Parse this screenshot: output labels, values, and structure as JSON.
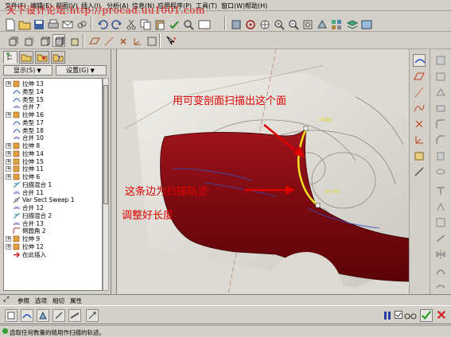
{
  "watermark": "天下设计论坛:http://procad.uu1001.com",
  "menu": {
    "items": [
      "文件(F)",
      "编辑(E)",
      "视图(V)",
      "插入(I)",
      "分析(A)",
      "信息(N)",
      "应用程序(P)",
      "工具(T)",
      "窗口(W)",
      "帮助(H)"
    ]
  },
  "panel": {
    "show_dropdown": "显示(S)",
    "settings_dropdown": "设置(G)",
    "tree": [
      {
        "label": "拉伸 13",
        "expand": true,
        "icon": "extrude-icon"
      },
      {
        "label": "类型 14",
        "expand": false,
        "icon": "sketch-icon"
      },
      {
        "label": "类型 15",
        "expand": false,
        "icon": "sketch-icon"
      },
      {
        "label": "合并 7",
        "expand": false,
        "icon": "merge-icon"
      },
      {
        "label": "拉伸 16",
        "expand": true,
        "icon": "extrude-icon"
      },
      {
        "label": "类型 17",
        "expand": false,
        "icon": "sketch-icon"
      },
      {
        "label": "类型 18",
        "expand": false,
        "icon": "sketch-icon"
      },
      {
        "label": "合并 10",
        "expand": false,
        "icon": "merge-icon"
      },
      {
        "label": "拉伸 8",
        "expand": true,
        "icon": "extrude-icon"
      },
      {
        "label": "拉伸 14",
        "expand": true,
        "icon": "extrude-icon"
      },
      {
        "label": "拉伸 15",
        "expand": true,
        "icon": "extrude-icon"
      },
      {
        "label": "拉伸 11",
        "expand": true,
        "icon": "extrude-icon"
      },
      {
        "label": "拉伸 6",
        "expand": true,
        "icon": "extrude-icon"
      },
      {
        "label": "扫描混合 1",
        "expand": false,
        "icon": "sweep-blend-icon"
      },
      {
        "label": "合并 11",
        "expand": false,
        "icon": "merge-icon"
      },
      {
        "label": "Var Sect Sweep 1",
        "expand": false,
        "icon": "var-sect-sweep-icon"
      },
      {
        "label": "合并 12",
        "expand": false,
        "icon": "merge-icon"
      },
      {
        "label": "扫描混合 2",
        "expand": false,
        "icon": "sweep-blend-icon"
      },
      {
        "label": "合并 13",
        "expand": false,
        "icon": "merge-icon"
      },
      {
        "label": "倒圆角 2",
        "expand": false,
        "icon": "round-icon"
      },
      {
        "label": "拉伸 9",
        "expand": true,
        "icon": "extrude-icon"
      },
      {
        "label": "拉伸 12",
        "expand": true,
        "icon": "extrude-icon"
      },
      {
        "label": "在此插入",
        "expand": false,
        "icon": "insert-here-arrow-icon"
      }
    ]
  },
  "viewport": {
    "annotation_top": "用可变剖面扫描出这个面",
    "annotation_mid": "这条边为扫描轨迹",
    "annotation_bottom": "调整好长度",
    "dim_label_1": "[长度]",
    "dim_label_2": "[0.00]"
  },
  "dashboard": {
    "tabs": [
      "参照",
      "选项",
      "相切",
      "属性"
    ]
  },
  "status": {
    "message": "选取任何数量的链用作扫描的轨迹。"
  },
  "colors": {
    "body_red": "#8b0d12",
    "annotation_red": "#e00000",
    "trajectory_yellow": "#f0e020",
    "background": "#d4d0c8"
  }
}
